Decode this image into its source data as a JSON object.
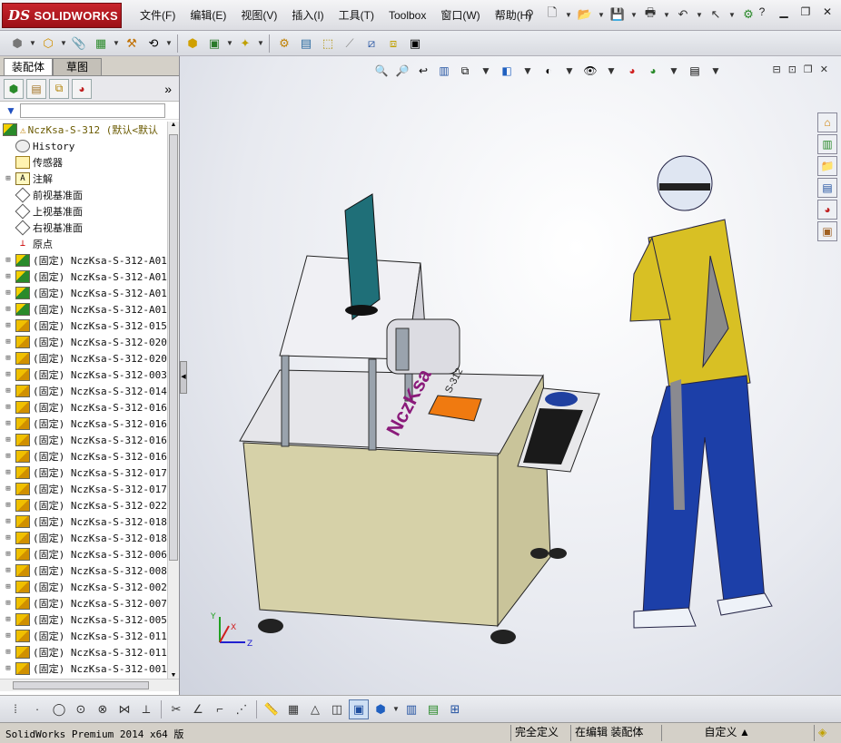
{
  "app": {
    "brand": "SOLIDWORKS",
    "brand_prefix": "DS"
  },
  "menu": [
    "文件(F)",
    "编辑(E)",
    "视图(V)",
    "插入(I)",
    "工具(T)",
    "Toolbox",
    "窗口(W)",
    "帮助(H)"
  ],
  "panel": {
    "tabs": [
      "装配体",
      "草图"
    ],
    "expand_glyph": "»"
  },
  "tree": {
    "root": "NczKsa-S-312  (默认<默认",
    "fixed": [
      {
        "label": "History",
        "icon": "history-icon"
      },
      {
        "label": "传感器",
        "icon": "sensor-icon"
      },
      {
        "label": "注解",
        "icon": "annotation-icon",
        "expandable": true
      },
      {
        "label": "前视基准面",
        "icon": "plane-icon"
      },
      {
        "label": "上视基准面",
        "icon": "plane-icon"
      },
      {
        "label": "右视基准面",
        "icon": "plane-icon"
      },
      {
        "label": "原点",
        "icon": "origin-icon"
      }
    ],
    "components": [
      {
        "label": "(固定) NczKsa-S-312-A01",
        "type": "assembly"
      },
      {
        "label": "(固定) NczKsa-S-312-A01",
        "type": "assembly"
      },
      {
        "label": "(固定) NczKsa-S-312-A01",
        "type": "assembly"
      },
      {
        "label": "(固定) NczKsa-S-312-A01",
        "type": "assembly"
      },
      {
        "label": "(固定) NczKsa-S-312-015",
        "type": "part"
      },
      {
        "label": "(固定) NczKsa-S-312-020",
        "type": "part"
      },
      {
        "label": "(固定) NczKsa-S-312-020",
        "type": "part"
      },
      {
        "label": "(固定) NczKsa-S-312-003",
        "type": "part"
      },
      {
        "label": "(固定) NczKsa-S-312-014",
        "type": "part"
      },
      {
        "label": "(固定) NczKsa-S-312-016",
        "type": "part"
      },
      {
        "label": "(固定) NczKsa-S-312-016",
        "type": "part"
      },
      {
        "label": "(固定) NczKsa-S-312-016",
        "type": "part"
      },
      {
        "label": "(固定) NczKsa-S-312-016",
        "type": "part"
      },
      {
        "label": "(固定) NczKsa-S-312-017",
        "type": "part"
      },
      {
        "label": "(固定) NczKsa-S-312-017",
        "type": "part"
      },
      {
        "label": "(固定) NczKsa-S-312-022",
        "type": "part"
      },
      {
        "label": "(固定) NczKsa-S-312-018",
        "type": "part"
      },
      {
        "label": "(固定) NczKsa-S-312-018",
        "type": "part"
      },
      {
        "label": "(固定) NczKsa-S-312-006",
        "type": "part"
      },
      {
        "label": "(固定) NczKsa-S-312-008",
        "type": "part"
      },
      {
        "label": "(固定) NczKsa-S-312-002",
        "type": "part"
      },
      {
        "label": "(固定) NczKsa-S-312-007",
        "type": "part"
      },
      {
        "label": "(固定) NczKsa-S-312-005",
        "type": "part"
      },
      {
        "label": "(固定) NczKsa-S-312-011",
        "type": "part"
      },
      {
        "label": "(固定) NczKsa-S-312-011",
        "type": "part"
      },
      {
        "label": "(固定) NczKsa-S-312-001",
        "type": "part"
      }
    ]
  },
  "model": {
    "label_brand": "NczKsa",
    "label_code": "S-312"
  },
  "triad": {
    "x": "X",
    "y": "Y",
    "z": "Z"
  },
  "status": {
    "app_version": "SolidWorks Premium 2014 x64 版",
    "definition": "完全定义",
    "mode": "在编辑 装配体",
    "units": "自定义"
  },
  "colors": {
    "machine_body": "#d6d1a8",
    "frame": "#9aa3ad",
    "monitor": "#1f6f78",
    "person_jacket": "#d8c024",
    "person_pants": "#1c3fa8",
    "orange_plate": "#f07a10",
    "logo_text": "#8a1a7a"
  }
}
